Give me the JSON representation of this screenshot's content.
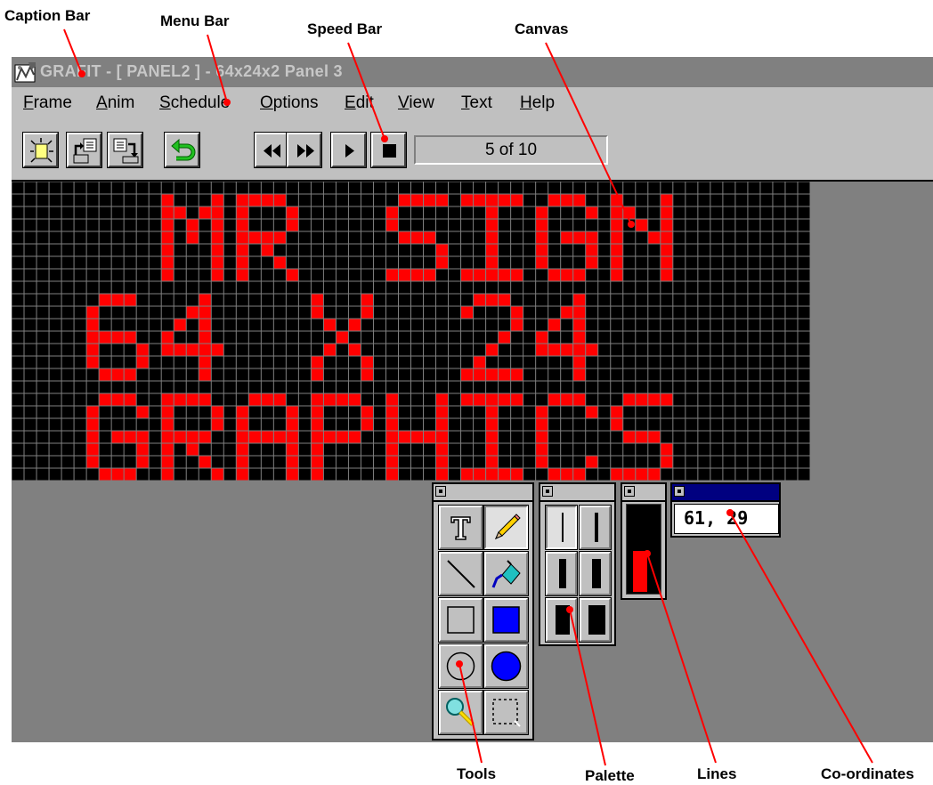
{
  "annotations": {
    "caption_bar": "Caption Bar",
    "menu_bar": "Menu Bar",
    "speed_bar": "Speed Bar",
    "canvas": "Canvas",
    "tools": "Tools",
    "palette": "Palette",
    "lines": "Lines",
    "coordinates": "Co-ordinates"
  },
  "window": {
    "title": "GRAFIT - [ PANEL2 ] - 64x24x2 Panel 3"
  },
  "menu": {
    "items": [
      {
        "hotkey": "F",
        "rest": "rame"
      },
      {
        "hotkey": "A",
        "rest": "nim"
      },
      {
        "hotkey": "S",
        "rest": "chedule"
      },
      {
        "hotkey": "O",
        "rest": "ptions"
      },
      {
        "hotkey": "E",
        "rest": "dit"
      },
      {
        "hotkey": "V",
        "rest": "iew"
      },
      {
        "hotkey": "T",
        "rest": "ext"
      },
      {
        "hotkey": "H",
        "rest": "elp"
      }
    ]
  },
  "toolbar": {
    "frame_counter": "5 of 10",
    "icons": [
      "new-frame-icon",
      "import-icon",
      "export-icon",
      "undo-icon",
      "rewind-icon",
      "fast-forward-icon",
      "play-icon",
      "stop-icon"
    ]
  },
  "canvas": {
    "grid_cols": 64,
    "grid_rows": 24,
    "led_on_color": "#ff0000",
    "led_off_color": "#000000",
    "grid_color": "#808080",
    "text_lines": [
      "MR SIGN",
      "64 X 24",
      "GRAPHICS"
    ]
  },
  "coordinates": {
    "value": "61, 29"
  },
  "colors": {
    "workspace": "#808080",
    "face": "#c0c0c0",
    "active_title": "#000080",
    "callout": "#ff0000"
  }
}
